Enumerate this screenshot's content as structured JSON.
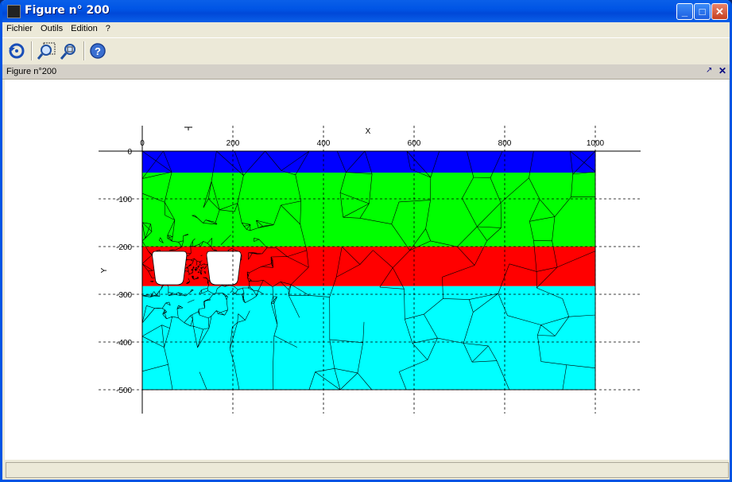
{
  "window": {
    "title": "Figure n° 200"
  },
  "titlebar_buttons": [
    "minimize",
    "maximize",
    "close"
  ],
  "menu": [
    "Fichier",
    "Outils",
    "Edition",
    "?"
  ],
  "toolbar": {
    "tools": [
      "refresh-icon",
      "zoom-in-icon",
      "zoom-fit-icon",
      "help-icon"
    ]
  },
  "panel": {
    "title": "Figure n°200"
  },
  "chart_data": {
    "type": "mesh",
    "xlabel": "X",
    "ylabel": "Y",
    "xlim": [
      0,
      1000
    ],
    "ylim": [
      -500,
      0
    ],
    "x_ticks": [
      0,
      200,
      400,
      600,
      800,
      1000
    ],
    "y_ticks": [
      0,
      -100,
      -200,
      -300,
      -400,
      -500
    ],
    "x_tick_labels": [
      "0",
      "200",
      "400",
      "600",
      "800",
      "1000"
    ],
    "y_tick_labels": [
      "0",
      "-100",
      "-200",
      "-300",
      "-400",
      "-500"
    ],
    "layers": [
      {
        "ymin": -45,
        "ymax": 0,
        "color": "#0000ff"
      },
      {
        "ymin": -200,
        "ymax": -45,
        "color": "#00ff00"
      },
      {
        "ymin": -283,
        "ymax": -200,
        "color": "#ff0000"
      },
      {
        "ymin": -500,
        "ymax": -283,
        "color": "#00ffff"
      }
    ],
    "holes": [
      {
        "xmin": 22,
        "xmax": 98,
        "ymin": -280,
        "ymax": -210
      },
      {
        "xmin": 142,
        "xmax": 218,
        "ymin": -280,
        "ymax": -210
      }
    ]
  }
}
